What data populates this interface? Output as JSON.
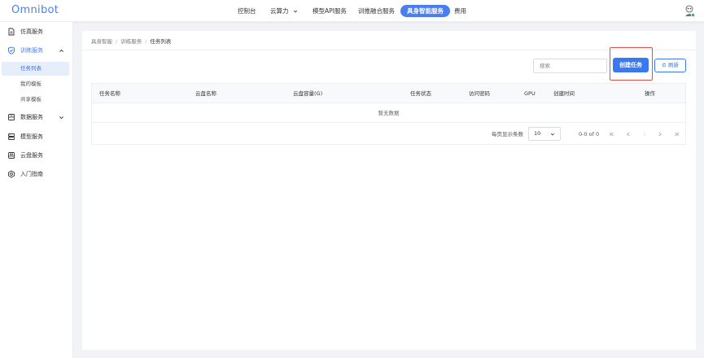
{
  "app": {
    "logo": "Omnibot"
  },
  "nav": {
    "items": [
      {
        "label": "控制台"
      },
      {
        "label": "云算力"
      },
      {
        "label": "模型API服务"
      },
      {
        "label": "训推融合服务"
      },
      {
        "label": "具身智能服务"
      },
      {
        "label": "费用"
      }
    ],
    "active_index": 4
  },
  "sidebar": {
    "items": [
      {
        "label": "仿真服务",
        "icon": "document-icon"
      },
      {
        "label": "训练服务",
        "icon": "shield-icon"
      },
      {
        "label": "数据服务",
        "icon": "database-icon"
      },
      {
        "label": "模型服务",
        "icon": "server-icon"
      },
      {
        "label": "云盘服务",
        "icon": "cloud-drive-icon"
      },
      {
        "label": "入门指南",
        "icon": "settings-icon"
      }
    ],
    "training_subitems": [
      {
        "label": "任务列表"
      },
      {
        "label": "我的模板"
      },
      {
        "label": "共享模板"
      }
    ]
  },
  "breadcrumb": [
    "具身智能",
    "训练服务",
    "任务列表"
  ],
  "toolbar": {
    "search_placeholder": "搜索",
    "create_label": "创建任务",
    "refresh_label": "刷新"
  },
  "table": {
    "columns": [
      "任务名称",
      "云盘名称",
      "云盘容量(G)",
      "任务状态",
      "访问密码",
      "GPU",
      "创建时间",
      "操作"
    ],
    "empty_text": "暂无数据"
  },
  "pagination": {
    "per_page_label": "每页显示条数",
    "per_page_value": "10",
    "range_text": "0-0 of 0"
  },
  "colors": {
    "accent": "#3a78f2",
    "highlight_border": "#ea4a4a",
    "active_sub_bg": "#e6eefc"
  }
}
